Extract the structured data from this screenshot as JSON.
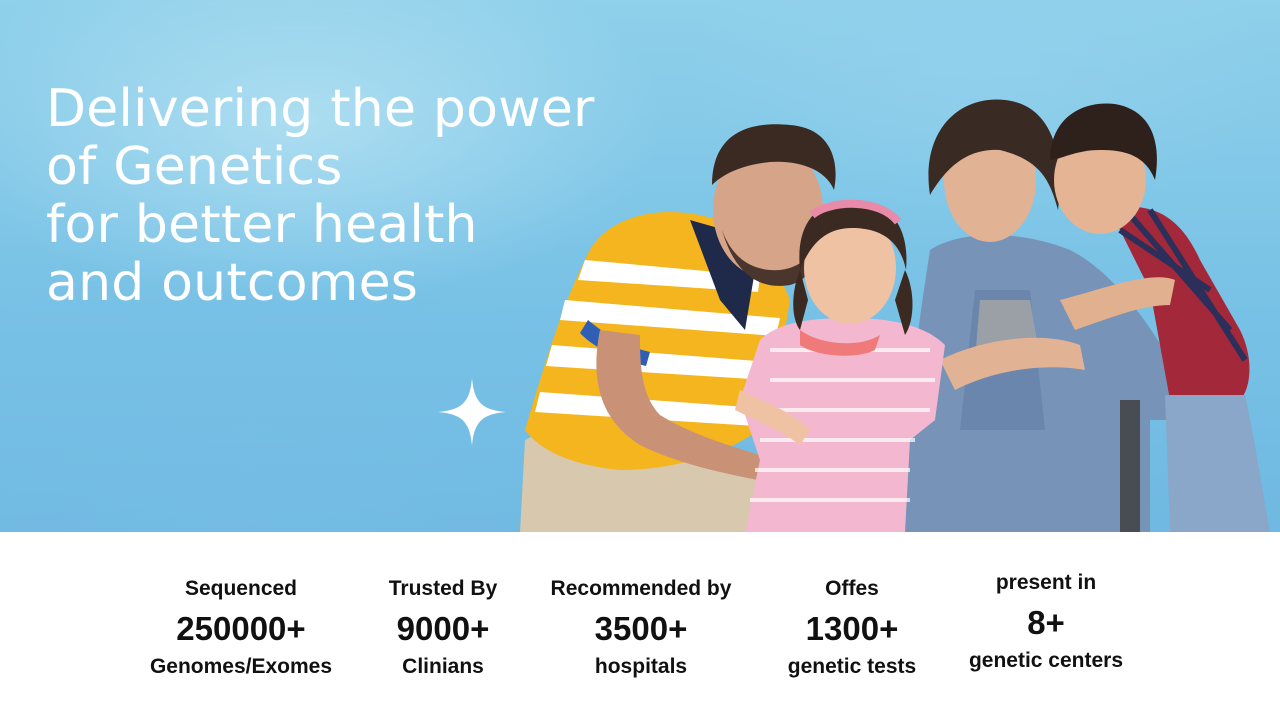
{
  "hero": {
    "headline_lines": [
      "Delivering the power",
      "of Genetics",
      "for better health",
      "and outcomes"
    ],
    "image_subject": "smiling family of four"
  },
  "stats": [
    {
      "top": "Sequenced",
      "number": "250000+",
      "bottom": "Genomes/Exomes"
    },
    {
      "top": "Trusted By",
      "number": "9000+",
      "bottom": "Clinians"
    },
    {
      "top": "Recommended by",
      "number": "3500+",
      "bottom": "hospitals"
    },
    {
      "top": "Offes",
      "number": "1300+",
      "bottom": "genetic tests"
    },
    {
      "top": "present in",
      "number": "8+",
      "bottom": "genetic centers"
    }
  ],
  "colors": {
    "sky": "#7cc5e8",
    "headline": "#ffffff",
    "stats_text": "#111111",
    "stats_bg": "#ffffff"
  }
}
